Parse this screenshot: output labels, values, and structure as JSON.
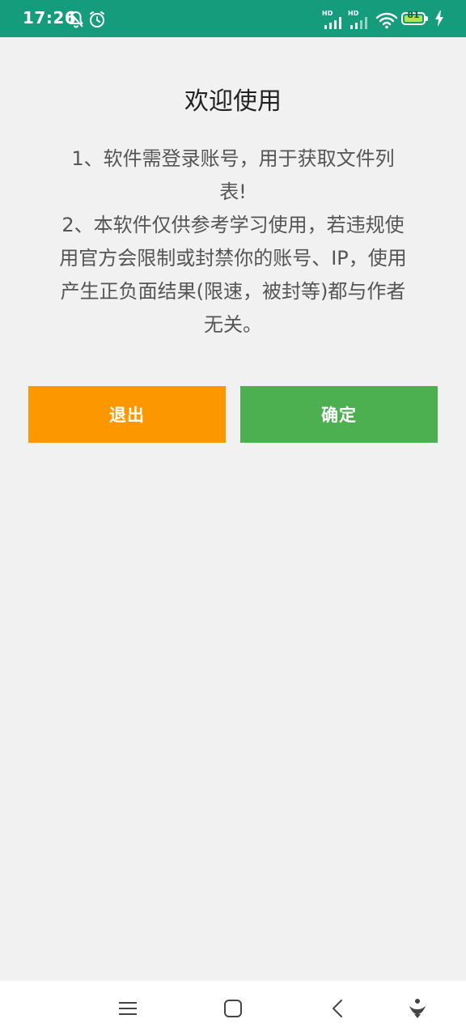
{
  "status_bar": {
    "time": "17:26",
    "hd_label_1": "HD",
    "hd_label_2": "HD",
    "battery_level": "81",
    "icons": [
      "bell-off-icon",
      "alarm-icon",
      "signal-icon",
      "signal-icon",
      "wifi-icon",
      "battery-icon",
      "charging-icon"
    ],
    "background_color": "#149c7c"
  },
  "dialog": {
    "title": "欢迎使用",
    "notice_lines": [
      "1、软件需登录账号，用于获取文件列",
      "表!",
      "2、本软件仅供参考学习使用，若违规使",
      "用官方会限制或封禁你的账号、IP，使用",
      "产生正负面结果(限速，被封等)都与作者",
      "无关。"
    ],
    "exit_button": "退出",
    "confirm_button": "确定",
    "exit_color": "#fd9700",
    "confirm_color": "#4caf50"
  },
  "nav_bar": {
    "icons": [
      "menu-icon",
      "home-icon",
      "back-icon",
      "accessibility-icon"
    ]
  }
}
